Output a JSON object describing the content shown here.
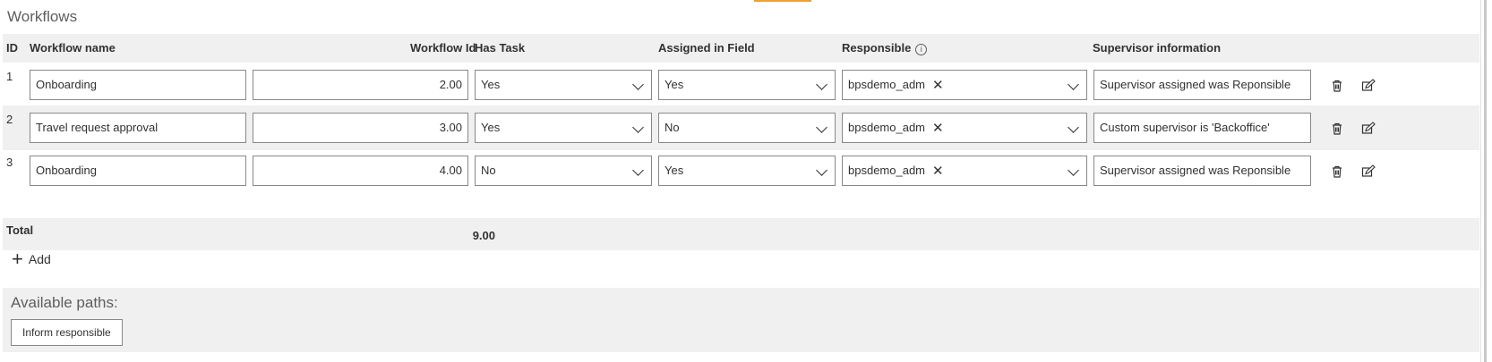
{
  "section_title": "Workflows",
  "columns": {
    "id": "ID",
    "name": "Workflow name",
    "workflow_id": "Workflow Id",
    "has_task": "Has Task",
    "assigned": "Assigned in Field",
    "responsible": "Responsible",
    "responsible_info_icon": "i",
    "supervisor": "Supervisor information"
  },
  "rows": [
    {
      "id": "1",
      "name": "Onboarding",
      "workflow_id": "2.00",
      "has_task": "Yes",
      "assigned": "Yes",
      "responsible": "bpsdemo_adm",
      "supervisor": "Supervisor assigned was Reponsible"
    },
    {
      "id": "2",
      "name": "Travel request approval",
      "workflow_id": "3.00",
      "has_task": "Yes",
      "assigned": "No",
      "responsible": "bpsdemo_adm",
      "supervisor": "Custom supervisor is 'Backoffice'"
    },
    {
      "id": "3",
      "name": "Onboarding",
      "workflow_id": "4.00",
      "has_task": "No",
      "assigned": "Yes",
      "responsible": "bpsdemo_adm",
      "supervisor": "Supervisor assigned was Reponsible"
    }
  ],
  "total": {
    "label": "Total",
    "value": "9.00"
  },
  "add_label": "Add",
  "paths": {
    "title": "Available paths:",
    "buttons": [
      "Inform responsible"
    ]
  },
  "icons": {
    "delete": "trash-icon",
    "edit": "edit-icon",
    "remove": "close-icon",
    "dropdown": "chevron-down-icon",
    "add": "plus-icon"
  },
  "colors": {
    "accent": "#f0a030",
    "row_alt_bg": "#f0f0f0",
    "border": "#8a8886"
  }
}
